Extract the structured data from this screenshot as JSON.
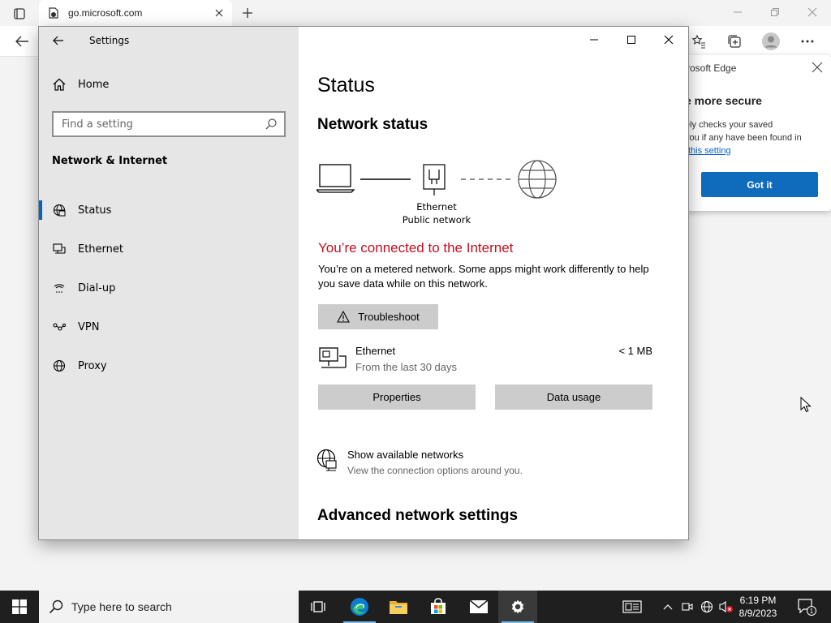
{
  "browser": {
    "tab_title": "go.microsoft.com",
    "popup": {
      "header": "rosoft Edge",
      "title": "e more secure",
      "body_line1": "ely checks your saved",
      "body_line2": "you if any have been found in",
      "link": "this setting",
      "button": "Got it"
    }
  },
  "settings": {
    "app_title": "Settings",
    "home_label": "Home",
    "search_placeholder": "Find a setting",
    "section_title": "Network & Internet",
    "nav_items": [
      {
        "label": "Status",
        "icon": "globe-status-icon",
        "active": true
      },
      {
        "label": "Ethernet",
        "icon": "ethernet-icon",
        "active": false
      },
      {
        "label": "Dial-up",
        "icon": "dialup-icon",
        "active": false
      },
      {
        "label": "VPN",
        "icon": "vpn-icon",
        "active": false
      },
      {
        "label": "Proxy",
        "icon": "globe-icon",
        "active": false
      }
    ],
    "main": {
      "page_title": "Status",
      "network_status_heading": "Network status",
      "adapter_label": "Ethernet",
      "network_type": "Public network",
      "connected_text": "You’re connected to the Internet",
      "metered_text": "You’re on a metered network. Some apps might work differently to help you save data while on this network.",
      "troubleshoot_label": "Troubleshoot",
      "connection_name": "Ethernet",
      "connection_period": "From the last 30 days",
      "connection_usage": "< 1 MB",
      "properties_label": "Properties",
      "data_usage_label": "Data usage",
      "show_networks_title": "Show available networks",
      "show_networks_sub": "View the connection options around you.",
      "advanced_heading": "Advanced network settings"
    }
  },
  "taskbar": {
    "search_placeholder": "Type here to search",
    "time": "6:19 PM",
    "date": "8/9/2023",
    "notification_count": "1"
  },
  "colors": {
    "accent": "#0067c0",
    "error_red": "#c50f1f",
    "edge_blue": "#0f6cbd",
    "nav_bg": "#e6e6e6",
    "taskbar_bg": "#1f1f1f"
  }
}
